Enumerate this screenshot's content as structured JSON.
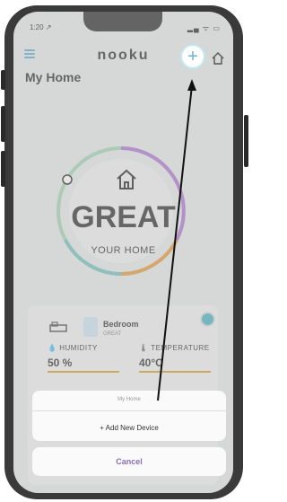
{
  "status": {
    "time": "1:20 ↗",
    "icons": "▂▄ ᯤ ▭"
  },
  "header": {
    "logo": "nooku"
  },
  "home": {
    "title": "My Home",
    "status_main": "GREAT",
    "status_sub": "YOUR HOME"
  },
  "room": {
    "name": "Bedroom",
    "status": "GREAT"
  },
  "metrics": {
    "humidity_label": "HUMIDITY",
    "humidity_value": "50 %",
    "temperature_label": "TEMPERATURE",
    "temperature_value": "40°C"
  },
  "sheet": {
    "title": "My Home",
    "add_label": "+ Add New Device",
    "cancel_label": "Cancel"
  },
  "colors": {
    "accent": "#6bb3d1",
    "bar": "#d4a63a",
    "cancel": "#8a6fb3"
  }
}
